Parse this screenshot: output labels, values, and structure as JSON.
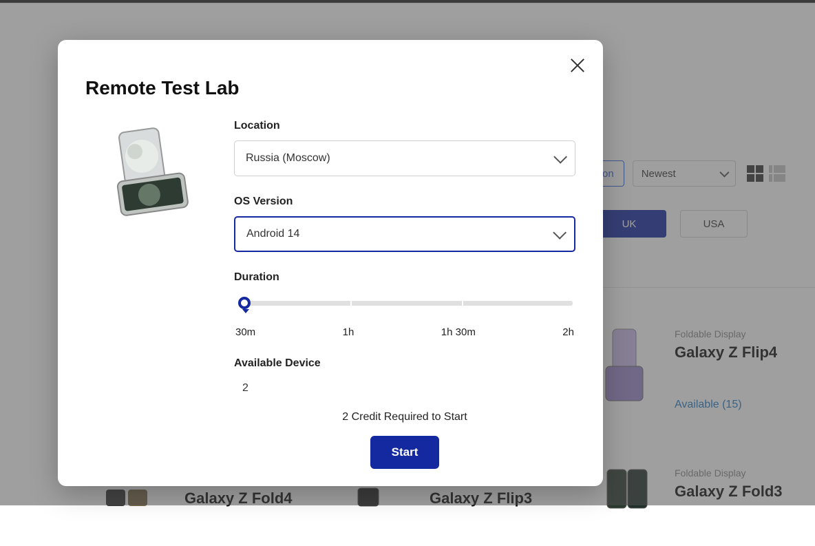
{
  "background": {
    "filter_on_suffix": "on",
    "sort_value": "Newest",
    "chip_uk": "UK",
    "chip_usa": "USA",
    "cards": [
      {
        "category": "Foldable Display",
        "name": "Galaxy Z Flip4",
        "availability": "Available (15)"
      },
      {
        "category": "Foldable Display",
        "name": "Galaxy Z Fold3"
      },
      {
        "name_only_a": "Galaxy Z Fold4"
      },
      {
        "name_only_b": "Galaxy Z Flip3"
      }
    ]
  },
  "modal": {
    "title": "Remote Test Lab",
    "location_label": "Location",
    "location_value": "Russia (Moscow)",
    "os_label": "OS Version",
    "os_value": "Android 14",
    "duration_label": "Duration",
    "ticks": {
      "t1": "30m",
      "t2": "1h",
      "t3": "1h 30m",
      "t4": "2h"
    },
    "available_label": "Available Device",
    "available_count": "2",
    "credit_text": "2 Credit Required to Start",
    "start_label": "Start"
  }
}
